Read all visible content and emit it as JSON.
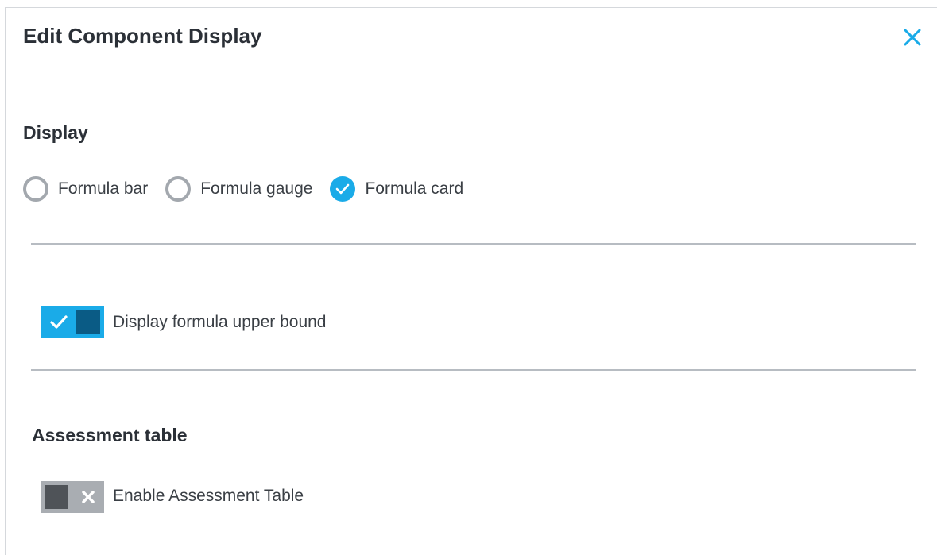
{
  "dialog": {
    "title": "Edit Component Display",
    "close_icon": "close-icon"
  },
  "display": {
    "section_title": "Display",
    "options": [
      {
        "label": "Formula bar",
        "checked": false
      },
      {
        "label": "Formula gauge",
        "checked": false
      },
      {
        "label": "Formula card",
        "checked": true
      }
    ]
  },
  "upper_bound": {
    "label": "Display formula upper bound",
    "enabled": true
  },
  "assessment": {
    "section_title": "Assessment table",
    "toggle_label": "Enable Assessment Table",
    "enabled": false
  },
  "colors": {
    "accent": "#1aabe8",
    "toggle_on_knob": "#0a5b85",
    "toggle_off_track": "#a9adb2",
    "toggle_off_knob": "#4f5358",
    "radio_unchecked": "#a3a8ae",
    "divider": "#b7bcc2",
    "text_dark": "#2b3037"
  }
}
